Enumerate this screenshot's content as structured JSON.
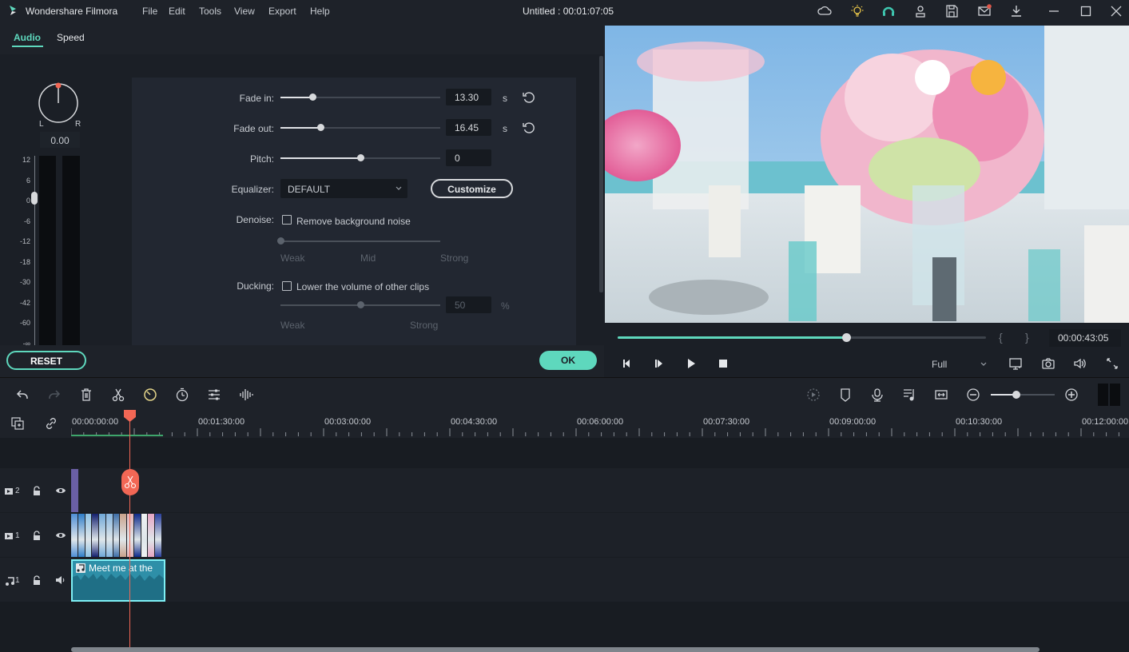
{
  "app": {
    "name": "Wondershare Filmora",
    "menu": [
      "File",
      "Edit",
      "Tools",
      "View",
      "Export",
      "Help"
    ],
    "document_title": "Untitled : 00:01:07:05",
    "title_icons": [
      "cloud-icon",
      "lightbulb-icon",
      "headset-support-icon",
      "account-icon",
      "save-icon",
      "mail-icon",
      "download-icon"
    ],
    "window_controls": [
      "minimize-icon",
      "maximize-icon",
      "close-icon"
    ],
    "accent_color": "#5ed8bd",
    "playhead_color": "#f26755"
  },
  "panel": {
    "tabs": [
      {
        "label": "Audio",
        "active": true
      },
      {
        "label": "Speed",
        "active": false
      }
    ],
    "pan": {
      "left_label": "L",
      "right_label": "R",
      "value": "0.00"
    },
    "volume_meter": {
      "ticks": [
        "12",
        "6",
        "0",
        "-6",
        "-12",
        "-18",
        "-30",
        "-42",
        "-60",
        "-∞"
      ],
      "value_db": 0
    },
    "fade_in": {
      "label": "Fade in:",
      "value": "13.30",
      "unit": "s",
      "fraction": 0.2
    },
    "fade_out": {
      "label": "Fade out:",
      "value": "16.45",
      "unit": "s",
      "fraction": 0.25
    },
    "pitch": {
      "label": "Pitch:",
      "value": "0",
      "fraction": 0.5
    },
    "equalizer": {
      "label": "Equalizer:",
      "selected": "DEFAULT",
      "customize_label": "Customize"
    },
    "denoise": {
      "label": "Denoise:",
      "checkbox_label": "Remove background noise",
      "checked": false,
      "scale": [
        "Weak",
        "Mid",
        "Strong"
      ],
      "fraction": 0.0
    },
    "ducking": {
      "label": "Ducking:",
      "checkbox_label": "Lower the volume of other clips",
      "checked": false,
      "value": "50",
      "unit": "%",
      "scale": [
        "Weak",
        "Strong"
      ],
      "fraction": 0.5
    },
    "reset_label": "RESET",
    "ok_label": "OK"
  },
  "preview": {
    "progress_fraction": 0.62,
    "mark_in": "{",
    "mark_out": "}",
    "timecode": "00:00:43:05",
    "quality": "Full",
    "controls": [
      "prev-frame-icon",
      "next-frame-icon",
      "play-icon",
      "stop-icon"
    ],
    "right_controls": [
      "display-settings-icon",
      "snapshot-icon",
      "volume-icon",
      "fullscreen-icon"
    ]
  },
  "timeline": {
    "toolbar_left": [
      "undo-icon",
      "redo-icon",
      "delete-icon",
      "cut-icon",
      "speed-icon",
      "duration-icon",
      "adjust-icon",
      "audio-wave-icon"
    ],
    "toolbar_right": [
      "render-preview-icon",
      "marker-icon",
      "voiceover-icon",
      "audio-mixer-icon",
      "fit-timeline-icon"
    ],
    "zoom_fraction": 0.4,
    "ruler_labels": [
      "00:00:00:00",
      "00:01:30:00",
      "00:03:00:00",
      "00:04:30:00",
      "00:06:00:00",
      "00:07:30:00",
      "00:09:00:00",
      "00:10:30:00",
      "00:12:00:00"
    ],
    "tracks": [
      {
        "type": "video",
        "number": "2",
        "icons": [
          "lock-icon",
          "eye-icon"
        ]
      },
      {
        "type": "video",
        "number": "1",
        "icons": [
          "lock-icon",
          "eye-icon"
        ]
      },
      {
        "type": "audio",
        "number": "1",
        "icons": [
          "lock-icon",
          "speaker-icon"
        ]
      }
    ],
    "audio_clip_title": "Meet me at the"
  }
}
